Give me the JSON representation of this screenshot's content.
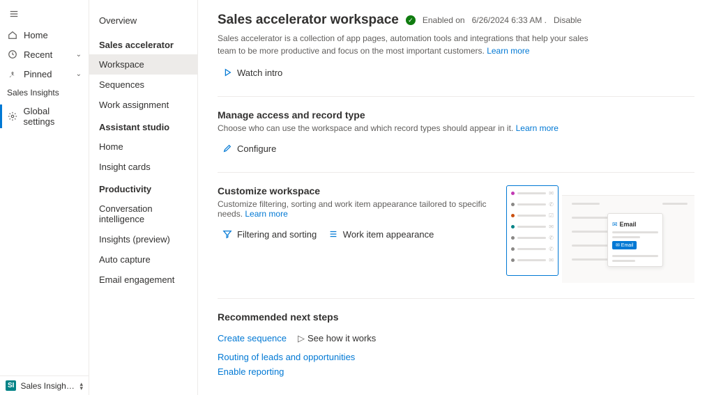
{
  "rail": {
    "items": [
      {
        "label": "Home"
      },
      {
        "label": "Recent"
      },
      {
        "label": "Pinned"
      }
    ],
    "group_label": "Sales Insights",
    "global_settings": "Global settings",
    "footer_badge": "SI",
    "footer_label": "Sales Insights sett..."
  },
  "subnav": {
    "overview": "Overview",
    "sections": [
      {
        "head": "Sales accelerator",
        "items": [
          "Workspace",
          "Sequences",
          "Work assignment"
        ]
      },
      {
        "head": "Assistant studio",
        "items": [
          "Home",
          "Insight cards"
        ]
      },
      {
        "head": "Productivity",
        "items": [
          "Conversation intelligence",
          "Insights (preview)",
          "Auto capture",
          "Email engagement"
        ]
      }
    ]
  },
  "main": {
    "title": "Sales accelerator workspace",
    "enabled_label": "Enabled on",
    "enabled_date": "6/26/2024 6:33 AM .",
    "disable": "Disable",
    "desc": "Sales accelerator is a collection of app pages, automation tools and integrations that help your sales team to be more productive and focus on the most important customers.",
    "learn_more": "Learn more",
    "watch_intro": "Watch intro",
    "manage": {
      "title": "Manage access and record type",
      "desc": "Choose who can use the workspace and which record types should appear in it.",
      "configure": "Configure"
    },
    "customize": {
      "title": "Customize workspace",
      "desc": "Customize filtering, sorting and work item appearance tailored to specific needs.",
      "filtering": "Filtering and sorting",
      "appearance": "Work item appearance",
      "ill_email": "Email",
      "ill_btn": "✉ Email"
    },
    "next": {
      "title": "Recommended next steps",
      "create_seq": "Create sequence",
      "see_how": "See how it works",
      "routing": "Routing of leads and opportunities",
      "enable_reporting": "Enable reporting"
    }
  }
}
